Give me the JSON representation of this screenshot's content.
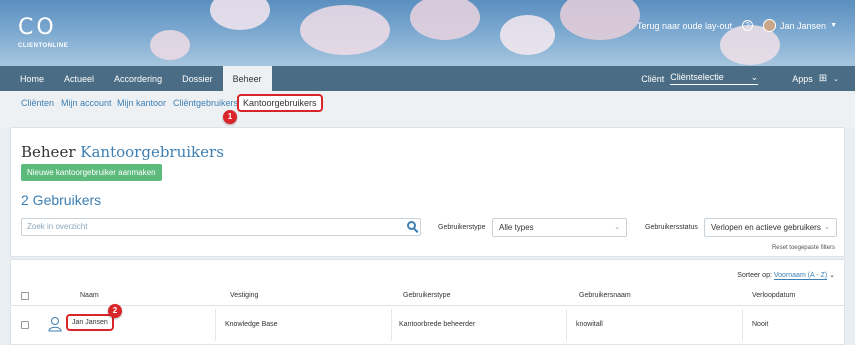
{
  "header": {
    "logo_mark": "C O",
    "logo_text": "CLIENTONLINE",
    "old_layout_link": "Terug naar oude lay-out",
    "help": "?",
    "user_name": "Jan Jansen"
  },
  "mainnav": {
    "items": [
      {
        "label": "Home"
      },
      {
        "label": "Actueel"
      },
      {
        "label": "Accordering"
      },
      {
        "label": "Dossier"
      },
      {
        "label": "Beheer"
      }
    ],
    "client_label": "Cliënt",
    "client_select": "Cliëntselectie",
    "apps_label": "Apps"
  },
  "subnav": {
    "items": [
      {
        "label": "Cliënten"
      },
      {
        "label": "Mijn account"
      },
      {
        "label": "Mijn kantoor"
      },
      {
        "label": "Cliëntgebruikers"
      },
      {
        "label": "Kantoorgebruikers"
      }
    ]
  },
  "markers": {
    "one": "1",
    "two": "2"
  },
  "page": {
    "title_prefix": "Beheer",
    "title_accent": "Kantoorgebruikers",
    "new_button": "Nieuwe kantoorgebruiker aanmaken",
    "count": "2 Gebruikers",
    "search_placeholder": "Zoek in overzicht",
    "filter_type_label": "Gebruikerstype",
    "filter_type_value": "Alle types",
    "filter_status_label": "Gebruikersstatus",
    "filter_status_value": "Verlopen en actieve gebruikers",
    "reset_filters": "Reset toegepaste filters"
  },
  "table": {
    "sort_label": "Sorteer op:",
    "sort_value": "Voornaam (A - Z)",
    "headers": {
      "name": "Naam",
      "location": "Vestiging",
      "type": "Gebruikerstype",
      "username": "Gebruikersnaam",
      "expiry": "Verloopdatum"
    },
    "rows": [
      {
        "name": "Jan Jansen",
        "location": "Knowledge Base",
        "type": "Kantoorbrede beheerder",
        "username": "knowitall",
        "expiry": "Nooit"
      }
    ]
  }
}
